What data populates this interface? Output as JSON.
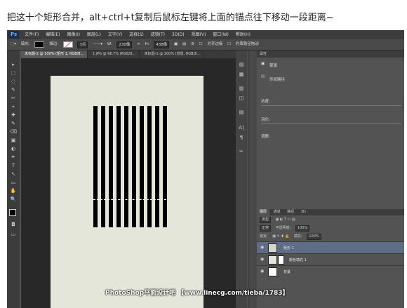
{
  "caption": "把这十个矩形合并，alt+ctrl+t复制后鼠标左键将上面的锚点往下移动一段距离~",
  "app": {
    "logo": "Ps"
  },
  "menu": [
    "文件(F)",
    "编辑(E)",
    "图像(I)",
    "图层(L)",
    "文字(Y)",
    "选择(S)",
    "滤镜(T)",
    "3D(D)",
    "视图(V)",
    "窗口(W)",
    "帮助(H)"
  ],
  "options": {
    "fill_label": "填充:",
    "stroke_label": "描边:",
    "stroke_size": "3点",
    "w_label": "W:",
    "w_value": "230像",
    "h_label": "H:",
    "h_value": "438像",
    "align_edges": "对齐边缘",
    "constrain_path": "约束路径拖动"
  },
  "doc_tabs": [
    "未标题-2 @ 100% (矩形 1, RGB/8...",
    "1.jPG @ 66.7% (RGB/8...",
    "未标题-1 @ 200% (背景, RGB/8..."
  ],
  "tools": [
    "▸",
    "⬚",
    "◌",
    "✎",
    "✂",
    "⌖",
    "✚",
    "✎",
    "⌫",
    "▣",
    "◐",
    "✒",
    "T",
    "↖",
    "▭",
    "✋",
    "🔍"
  ],
  "dock_icons": [
    "▤",
    "▦",
    "▥",
    "◫",
    "▧",
    "A|",
    "¶",
    "✂"
  ],
  "properties": {
    "panel_title": "属性",
    "mask_label": "蒙版",
    "vector_mask_label": "形状路径",
    "density_label": "浓度:",
    "feather_label": "羽化:",
    "refine_label": "调整:"
  },
  "layers_panel": {
    "tabs": [
      "图层",
      "通道",
      "路径",
      "3D"
    ],
    "kind_label": "类型",
    "blend_mode": "正常",
    "opacity_label": "不透明度:",
    "opacity_value": "100%",
    "lock_label": "锁定:",
    "fill_label": "填充:",
    "fill_value": "100%",
    "layers": [
      {
        "name": "矩形 1",
        "active": true
      },
      {
        "name": "颜色填充 1",
        "active": false
      },
      {
        "name": "背景",
        "active": false
      }
    ]
  },
  "watermark": "PhotoShop平面设计吧 【www.linecg.com/tieba/1783】",
  "colors": {
    "canvas": "#e5e6da",
    "bars": "#000000",
    "active_layer": "#5e6c85"
  }
}
